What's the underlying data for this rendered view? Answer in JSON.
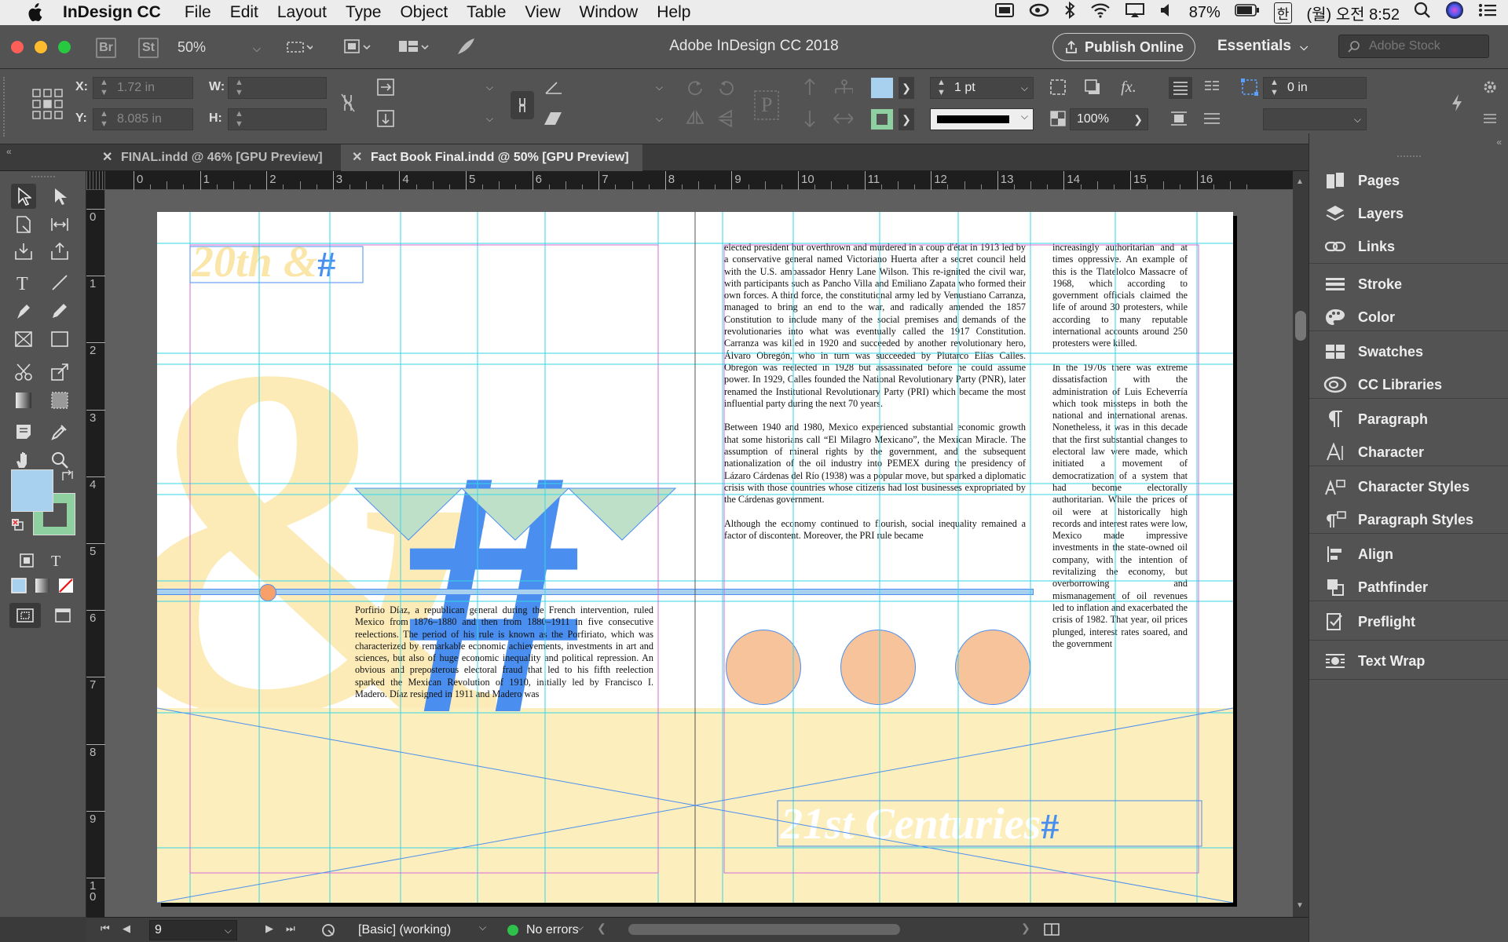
{
  "menubar": {
    "app_name": "InDesign CC",
    "items": [
      "File",
      "Edit",
      "Layout",
      "Type",
      "Object",
      "Table",
      "View",
      "Window",
      "Help"
    ],
    "battery": "87%",
    "ime": "한",
    "clock": "(월) 오전 8:52"
  },
  "titlebar": {
    "bridge": "Br",
    "stock_btn": "St",
    "zoom": "50%",
    "title": "Adobe InDesign CC 2018",
    "publish": "Publish Online",
    "workspace": "Essentials",
    "stock_placeholder": "Adobe Stock"
  },
  "control": {
    "x_label": "X:",
    "x_value": "1.72 in",
    "y_label": "Y:",
    "y_value": "8.085 in",
    "w_label": "W:",
    "h_label": "H:",
    "stroke_weight": "1 pt",
    "opacity": "100%",
    "offset": "0 in",
    "fx": "fx."
  },
  "tabs": [
    {
      "label": "FINAL.indd @ 46% [GPU Preview]"
    },
    {
      "label": "Fact Book Final.indd @ 50% [GPU Preview]"
    }
  ],
  "ruler": {
    "h": [
      "0",
      "1",
      "2",
      "3",
      "4",
      "5",
      "6",
      "7",
      "8",
      "9",
      "10",
      "11",
      "12",
      "13",
      "14",
      "15",
      "16"
    ],
    "v": [
      "0",
      "1",
      "2",
      "3",
      "4",
      "5",
      "6",
      "7",
      "8",
      "9",
      "1\n0"
    ]
  },
  "document": {
    "heading_top": "20th &",
    "heading_top_hash": "#",
    "heading_bottom": "21st Centuries",
    "heading_bottom_hash": "#",
    "amp": "&",
    "hash": "#",
    "col1": "Porfirio Díaz, a republican general during the French intervention, ruled Mexico from 1876–1880 and then from 1880–1911 in five consecutive reelections. The period of his rule is known as the Porfiriato, which was characterized by remarkable economic achievements, investments in art and sciences, but also of huge economic inequality and political repression. An obvious and preposterous electoral fraud that led to his fifth reelection sparked the Mexican Revolution of 1910, initially led by Francisco I. Madero. Díaz resigned in 1911 and Madero was",
    "col2_p1": "elected president but overthrown and murdered in a coup d'état in 1913 led by a conservative general named Victoriano Huerta after a secret council held with the U.S. ambassador Henry Lane Wilson. This re-ignited the civil war, with participants such as Pancho Villa and Emiliano Zapata who formed their own forces. A third force, the constitutional army led by Venustiano Carranza, managed to bring an end to the war, and radically amended the 1857 Constitution to include many of the social premises and demands of the revolutionaries into what was eventually called the 1917 Constitution. Carranza was killed in 1920 and succeeded by another revolutionary hero, Álvaro Obregón, who in turn was succeeded by Plutarco Elías Calles. Obregón was reelected in 1928 but assassinated before he could assume power. In 1929, Calles founded the National Revolutionary Party (PNR), later renamed the Institutional Revolutionary Party (PRI) which became the most influential party during the next 70 years.",
    "col2_p2": "Between 1940 and 1980, Mexico experienced substantial economic growth that some historians call “El Milagro Mexicano”, the Mexican Miracle. The assumption of mineral rights by the government, and the subsequent nationalization of the oil industry into PEMEX during the presidency of Lázaro Cárdenas del Río (1938) was a popular move, but sparked a diplomatic crisis with those countries whose citizens had lost businesses expropriated by the Cárdenas government.",
    "col2_p3": "Although the economy continued to flourish, social inequality remained a factor of discontent. Moreover, the PRI rule became",
    "col3_p1": "increasingly authoritarian and at times oppressive. An example of this is the Tlatelolco Massacre of 1968, which according to government officials claimed the life of around 30 protesters, while according to many reputable international accounts around 250 protesters were killed.",
    "col3_p2": "In the 1970s there was extreme dissatisfaction with the administration of Luis Echeverría which took missteps in both the national and international arenas. Nonetheless, it was in this decade that the first substantial changes to electoral law were made, which initiated a movement of democratization of a system that had become electorally authoritarian. While the prices of oil were at historically high records and interest rates were low, Mexico made impressive investments in the state-owned oil company, with the intention of revitalizing the economy, but overborrowing and mismanagement of oil revenues led to inflation and exacerbated the crisis of 1982. That year, oil prices plunged, interest rates soared, and the government"
  },
  "panels": {
    "items": [
      "Pages",
      "Layers",
      "Links",
      "Stroke",
      "Color",
      "Swatches",
      "CC Libraries",
      "Paragraph",
      "Character",
      "Character Styles",
      "Paragraph Styles",
      "Align",
      "Pathfinder",
      "Preflight",
      "Text Wrap"
    ]
  },
  "status": {
    "page": "9",
    "style": "[Basic] (working)",
    "errors": "No errors"
  },
  "colors": {
    "light_blue": "#a8d1ef",
    "mint": "#8fd0a0",
    "cream": "#fdeebd",
    "peach": "#f7c39a",
    "bright_blue": "#4a8ff0",
    "guide_cyan": "#34d6e8",
    "margin_magenta": "#d86bd4",
    "ok_green": "#2ec14b"
  }
}
